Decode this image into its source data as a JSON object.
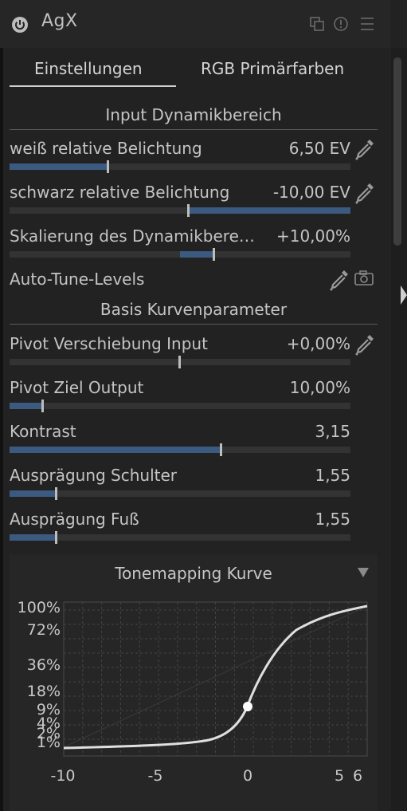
{
  "header": {
    "title": "AgX"
  },
  "tabs": [
    {
      "label": "Einstellungen",
      "active": true
    },
    {
      "label": "RGB Primärfarben",
      "active": false
    }
  ],
  "sections": {
    "input": "Input Dynamikbereich",
    "basis": "Basis Kurvenparameter"
  },
  "sliders": {
    "weiss": {
      "label": "weiß relative Belichtung",
      "value": "6,50 EV"
    },
    "schwarz": {
      "label": "schwarz relative Belichtung",
      "value": "-10,00 EV"
    },
    "skalierung": {
      "label": "Skalierung des Dynamikbere…",
      "value": "+10,00%"
    },
    "pivot_in": {
      "label": "Pivot Verschiebung Input",
      "value": "+0,00%"
    },
    "pivot_out": {
      "label": "Pivot Ziel Output",
      "value": "10,00%"
    },
    "kontrast": {
      "label": "Kontrast",
      "value": "3,15"
    },
    "schulter": {
      "label": "Ausprägung Schulter",
      "value": "1,55"
    },
    "fuss": {
      "label": "Ausprägung Fuß",
      "value": "1,55"
    }
  },
  "autotune": {
    "label": "Auto-Tune-Levels"
  },
  "curve": {
    "title": "Tonemapping Kurve",
    "y_ticks": [
      "100%",
      "72%",
      "36%",
      "18%",
      "9%",
      "4%",
      "2%",
      "1%"
    ],
    "x_ticks": [
      "-10",
      "-5",
      "0",
      "5",
      "6"
    ]
  },
  "colors": {
    "accent": "#3c5a80",
    "background": "#222222"
  },
  "icons": {
    "power": "power-icon",
    "presets": "presets-icon",
    "reset": "reset-icon",
    "menu": "hamburger-menu-icon",
    "picker": "color-picker-icon",
    "camera": "camera-icon",
    "collapse": "triangle-down-icon"
  }
}
